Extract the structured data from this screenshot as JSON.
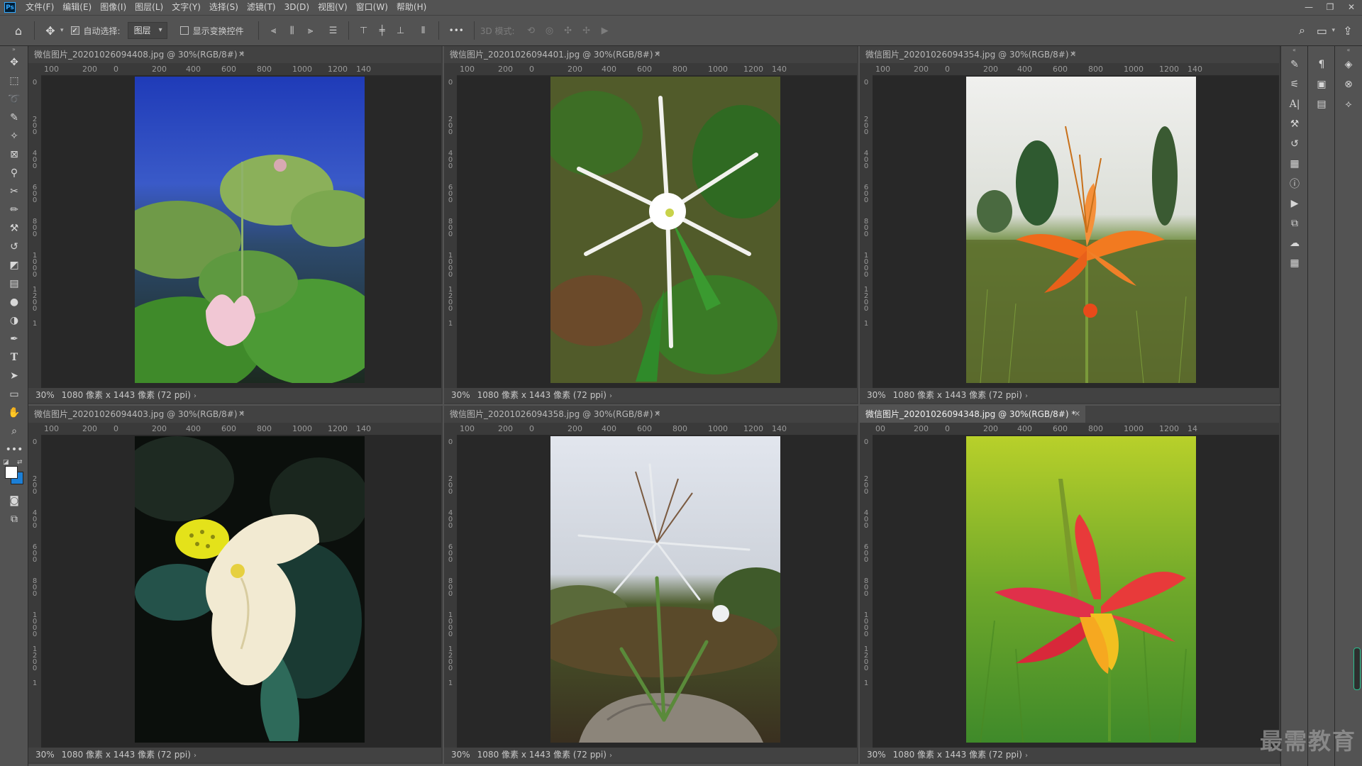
{
  "app": {
    "logo": "Ps",
    "menu": [
      "文件(F)",
      "编辑(E)",
      "图像(I)",
      "图层(L)",
      "文字(Y)",
      "选择(S)",
      "滤镜(T)",
      "3D(D)",
      "视图(V)",
      "窗口(W)",
      "帮助(H)"
    ]
  },
  "options": {
    "auto_select_label": "自动选择:",
    "auto_select_checked": true,
    "layer_dropdown": "图层",
    "show_transform_label": "显示变换控件",
    "show_transform_checked": false,
    "more": "•••",
    "mode_3d": "3D 模式:"
  },
  "ruler": {
    "top": [
      "100",
      "200",
      "0",
      "200",
      "400",
      "600",
      "800",
      "1000",
      "1200",
      "140"
    ],
    "top_last": [
      "00",
      "200",
      "0",
      "200",
      "400",
      "600",
      "800",
      "1000",
      "1200",
      "14"
    ],
    "left": [
      "0",
      "2 0 0",
      "4 0 0",
      "6 0 0",
      "8 0 0",
      "1 0 0 0",
      "1 2 0 0",
      "1"
    ]
  },
  "documents": [
    {
      "title": "微信图片_20201026094408.jpg @ 30%(RGB/8#) *",
      "zoom": "30%",
      "info": "1080 像素 x 1443 像素 (72 ppi)",
      "active": false
    },
    {
      "title": "微信图片_20201026094401.jpg @ 30%(RGB/8#) *",
      "zoom": "30%",
      "info": "1080 像素 x 1443 像素 (72 ppi)",
      "active": false
    },
    {
      "title": "微信图片_20201026094354.jpg @ 30%(RGB/8#) *",
      "zoom": "30%",
      "info": "1080 像素 x 1443 像素 (72 ppi)",
      "active": false
    },
    {
      "title": "微信图片_20201026094403.jpg @ 30%(RGB/8#) *",
      "zoom": "30%",
      "info": "1080 像素 x 1443 像素 (72 ppi)",
      "active": false
    },
    {
      "title": "微信图片_20201026094358.jpg @ 30%(RGB/8#) *",
      "zoom": "30%",
      "info": "1080 像素 x 1443 像素 (72 ppi)",
      "active": false
    },
    {
      "title": "微信图片_20201026094348.jpg @ 30%(RGB/8#) *",
      "zoom": "30%",
      "info": "1080 像素 x 1443 像素 (72 ppi)",
      "active": true
    }
  ],
  "colors": {
    "foreground": "#ffffff",
    "background": "#1c7fd6",
    "accent": "#31a8ff"
  },
  "watermark": "最需教育"
}
